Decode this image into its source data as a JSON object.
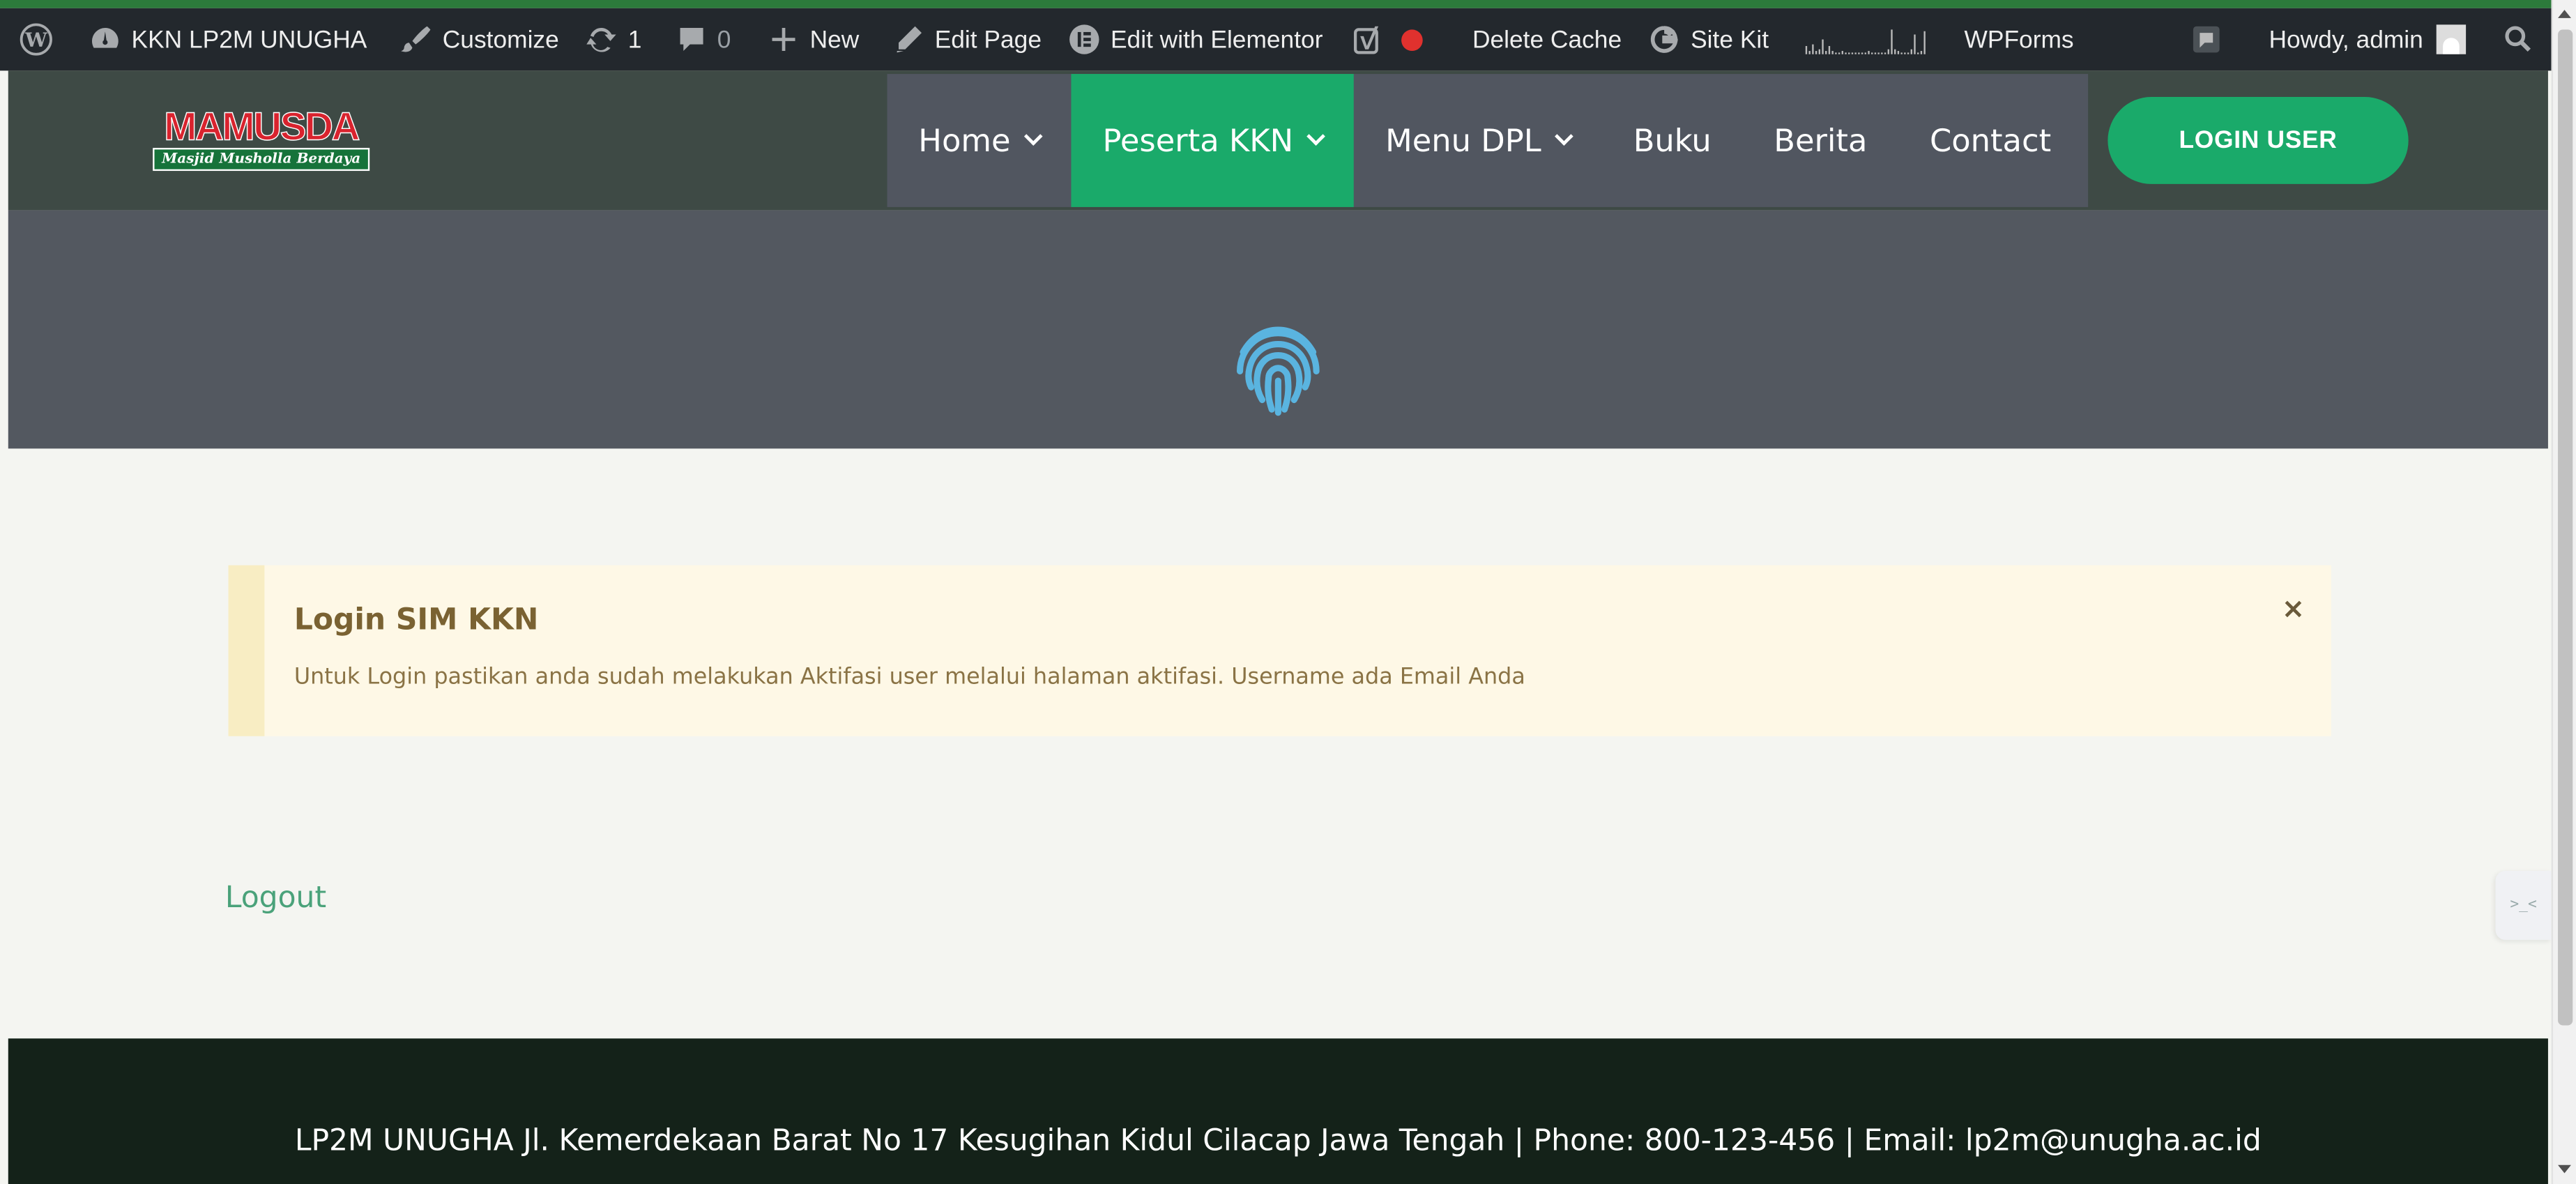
{
  "adminbar": {
    "site_name": "KKN LP2M UNUGHA",
    "customize": "Customize",
    "updates_count": "1",
    "comments_count": "0",
    "new_label": "New",
    "edit_page": "Edit Page",
    "edit_elementor": "Edit with Elementor",
    "delete_cache": "Delete Cache",
    "site_kit": "Site Kit",
    "wpforms": "WPForms",
    "howdy": "Howdy, admin"
  },
  "header": {
    "logo_title": "MAMUSDA",
    "logo_subtitle": "Masjid Musholla Berdaya",
    "nav": [
      {
        "label": "Home"
      },
      {
        "label": "Peserta KKN"
      },
      {
        "label": "Menu DPL"
      },
      {
        "label": "Buku"
      },
      {
        "label": "Berita"
      },
      {
        "label": "Contact"
      }
    ],
    "login_button": "LOGIN USER"
  },
  "notice": {
    "title": "Login SIM KKN",
    "text": "Untuk Login pastikan anda sudah melakukan Aktifasi user melalui halaman aktifasi. Username ada Email Anda",
    "close": "×"
  },
  "content": {
    "logout_link": "Logout"
  },
  "footer": {
    "text": "LP2M UNUGHA Jl. Kemerdekaan Barat No 17 Kesugihan Kidul Cilacap Jawa Tengah | Phone: 800-123-456 | Email: lp2m@unugha.ac.id"
  },
  "colors": {
    "accent_green": "#1aaa6a",
    "adminbar_bg": "#23282d",
    "footer_bg": "#142219",
    "fingerprint_blue": "#5ab4e0"
  }
}
